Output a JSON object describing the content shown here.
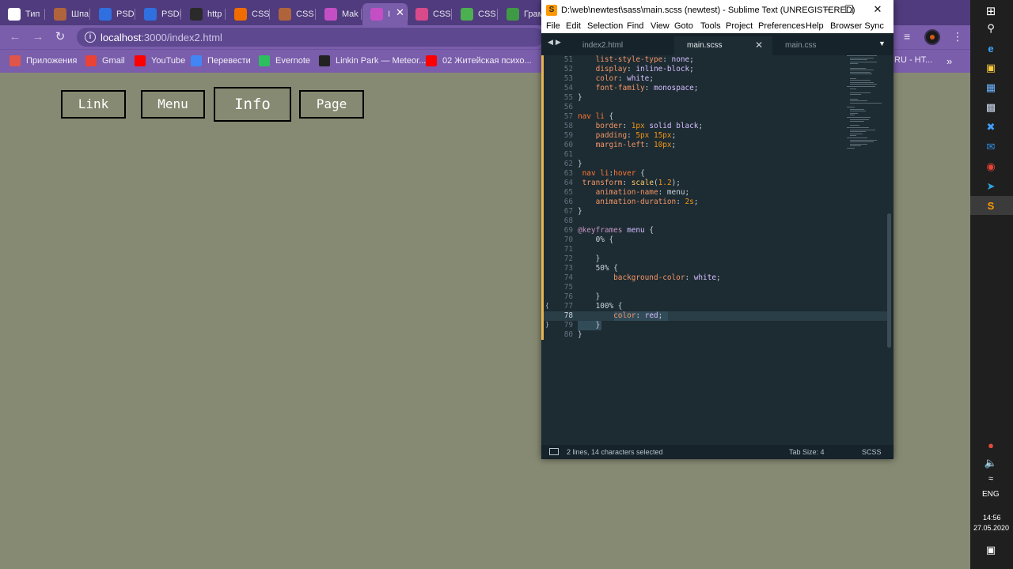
{
  "browser": {
    "tabs": [
      {
        "title": "Тип",
        "icon": "bookmark-icon",
        "color": "#ffffff"
      },
      {
        "title": "Шпа",
        "icon": "monk-icon",
        "color": "#b0643c"
      },
      {
        "title": "PSDI",
        "icon": "ps-icon",
        "color": "#2f6fe0"
      },
      {
        "title": "PSDI",
        "icon": "ps-icon",
        "color": "#2f6fe0"
      },
      {
        "title": "http",
        "icon": "caret-icon",
        "color": "#2a2a2a"
      },
      {
        "title": "CSS-",
        "icon": "css-icon",
        "color": "#ef6c00"
      },
      {
        "title": "CSS",
        "icon": "monk-icon",
        "color": "#b0643c"
      },
      {
        "title": "Mak",
        "icon": "circle-icon",
        "color": "#c44fc4"
      },
      {
        "title": "I",
        "icon": "globe-icon",
        "color": "#c44fc4"
      },
      {
        "title": "CSS",
        "icon": "grid-icon",
        "color": "#d84a8a"
      },
      {
        "title": "CSS",
        "icon": "w3-icon",
        "color": "#4caf50"
      },
      {
        "title": "Грам",
        "icon": "leaf-icon",
        "color": "#3e9a45"
      }
    ],
    "url_host": "localhost",
    "url_path": ":3000/index2.html",
    "bookmarks": [
      {
        "label": "Приложения",
        "icon": "apps-grid-icon",
        "color": "#e0554a"
      },
      {
        "label": "Gmail",
        "icon": "gmail-icon",
        "color": "#ea4335"
      },
      {
        "label": "YouTube",
        "icon": "youtube-icon",
        "color": "#ff0000"
      },
      {
        "label": "Перевести",
        "icon": "translate-icon",
        "color": "#4285f4"
      },
      {
        "label": "Evernote",
        "icon": "evernote-icon",
        "color": "#2dbe60"
      },
      {
        "label": "Linkin Park — Meteor...",
        "icon": "slash-icon",
        "color": "#222222"
      },
      {
        "label": "02 Житейская психо...",
        "icon": "youtube-icon",
        "color": "#ff0000"
      }
    ],
    "bookmark_overflow": "RU - HT..."
  },
  "page": {
    "nav": [
      "Link",
      "Menu",
      "Info",
      "Page"
    ]
  },
  "editor": {
    "title": "D:\\web\\newtest\\sass\\main.scss (newtest) - Sublime Text (UNREGISTERED)",
    "menu": [
      "File",
      "Edit",
      "Selection",
      "Find",
      "View",
      "Goto",
      "Tools",
      "Project",
      "Preferences",
      "Help",
      "Browser Sync"
    ],
    "tabs": [
      {
        "label": "index2.html",
        "active": false
      },
      {
        "label": "main.scss",
        "active": true
      },
      {
        "label": "main.css",
        "active": false
      }
    ],
    "status_selection": "2 lines, 14 characters selected",
    "tab_size": "Tab Size: 4",
    "syntax": "SCSS",
    "lines": [
      {
        "n": "51",
        "html": "    <span class='c-prop'>list-style-type</span>: <span class='c-val'>none</span>;"
      },
      {
        "n": "52",
        "html": "    <span class='c-prop'>display</span>: <span class='c-val'>inline-block</span>;"
      },
      {
        "n": "53",
        "html": "    <span class='c-prop'>color</span>: <span class='c-val'>white</span>;"
      },
      {
        "n": "54",
        "html": "    <span class='c-prop'>font-family</span>: <span class='c-val'>monospace</span>;"
      },
      {
        "n": "55",
        "html": "}"
      },
      {
        "n": "56",
        "html": ""
      },
      {
        "n": "57",
        "html": "<span class='c-sel'>nav</span> <span class='c-sel'>li</span> {"
      },
      {
        "n": "58",
        "html": "    <span class='c-prop'>border</span>: <span class='c-num'>1px</span> <span class='c-val'>solid</span> <span class='c-val'>black</span>;"
      },
      {
        "n": "59",
        "html": "    <span class='c-prop'>padding</span>: <span class='c-num'>5px</span> <span class='c-num'>15px</span>;"
      },
      {
        "n": "60",
        "html": "    <span class='c-prop'>margin-left</span>: <span class='c-num'>10px</span>;"
      },
      {
        "n": "61",
        "html": ""
      },
      {
        "n": "62",
        "html": "}"
      },
      {
        "n": "63",
        "html": " <span class='c-sel'>nav</span> <span class='c-sel'>li</span>:<span class='c-sel'>hover</span> {"
      },
      {
        "n": "64",
        "html": " <span class='c-prop'>transform</span>: <span class='c-fn'>scale</span>(<span class='c-num'>1.2</span>);"
      },
      {
        "n": "65",
        "html": "    <span class='c-prop'>animation-name</span>: <span class='c-def'>menu</span>;"
      },
      {
        "n": "66",
        "html": "    <span class='c-prop'>animation-duration</span>: <span class='c-num'>2s</span>;"
      },
      {
        "n": "67",
        "html": "}"
      },
      {
        "n": "68",
        "html": ""
      },
      {
        "n": "69",
        "html": "<span class='c-at'>@keyframes</span> <span class='c-val'>menu</span> {"
      },
      {
        "n": "70",
        "html": "    <span class='c-def'>0%</span> {"
      },
      {
        "n": "71",
        "html": ""
      },
      {
        "n": "72",
        "html": "    }"
      },
      {
        "n": "73",
        "html": "    <span class='c-def'>50%</span> {"
      },
      {
        "n": "74",
        "html": "        <span class='c-prop'>background-color</span>: <span class='c-val'>white</span>;"
      },
      {
        "n": "75",
        "html": ""
      },
      {
        "n": "76",
        "html": "    }"
      },
      {
        "n": "77",
        "html": "    <span class='c-def'>100%</span> {"
      },
      {
        "n": "78",
        "html": "        <span class='c-prop'>color</span>: <span class='c-val'>red</span>;"
      },
      {
        "n": "79",
        "html": "    }"
      },
      {
        "n": "80",
        "html": "}"
      }
    ]
  },
  "taskbar": {
    "lang": "ENG",
    "time": "14:56",
    "date": "27.05.2020"
  }
}
